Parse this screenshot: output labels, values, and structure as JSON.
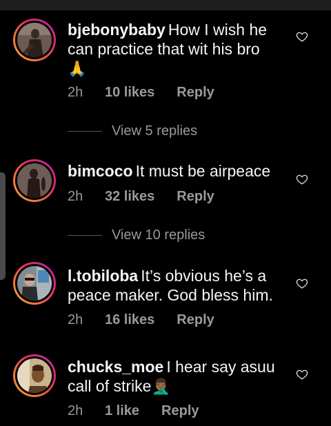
{
  "comments": [
    {
      "username": "bjebonybaby",
      "text": "How I wish he can practice that wit his bro",
      "emoji": "🙏",
      "time": "2h",
      "likes": "10 likes",
      "reply_label": "Reply",
      "avatar": "avatar-photo"
    },
    {
      "username": "bimcoco",
      "text": "It must be airpeace",
      "emoji": "",
      "time": "2h",
      "likes": "32 likes",
      "reply_label": "Reply",
      "avatar": "avatar-photo"
    },
    {
      "username": "l.tobiloba",
      "text": "It’s obvious he’s a peace maker. God bless him.",
      "emoji": "",
      "time": "2h",
      "likes": "16 likes",
      "reply_label": "Reply",
      "avatar": "avatar-photo"
    },
    {
      "username": "chucks_moe",
      "text": "I hear say asuu call of strike",
      "emoji": "🤦🏾‍♂️",
      "time": "2h",
      "likes": "1 like",
      "reply_label": "Reply",
      "avatar": "avatar-photo"
    }
  ],
  "view_replies": [
    {
      "label": "View 5 replies"
    },
    {
      "label": "View 10 replies"
    }
  ],
  "icons": {
    "like": "heart-outline-icon"
  },
  "colors": {
    "background": "#000000",
    "text": "#f5f5f5",
    "secondary_text": "#9a9a9a",
    "story_ring": [
      "#f9a53a",
      "#e0286a",
      "#b728b0"
    ]
  }
}
